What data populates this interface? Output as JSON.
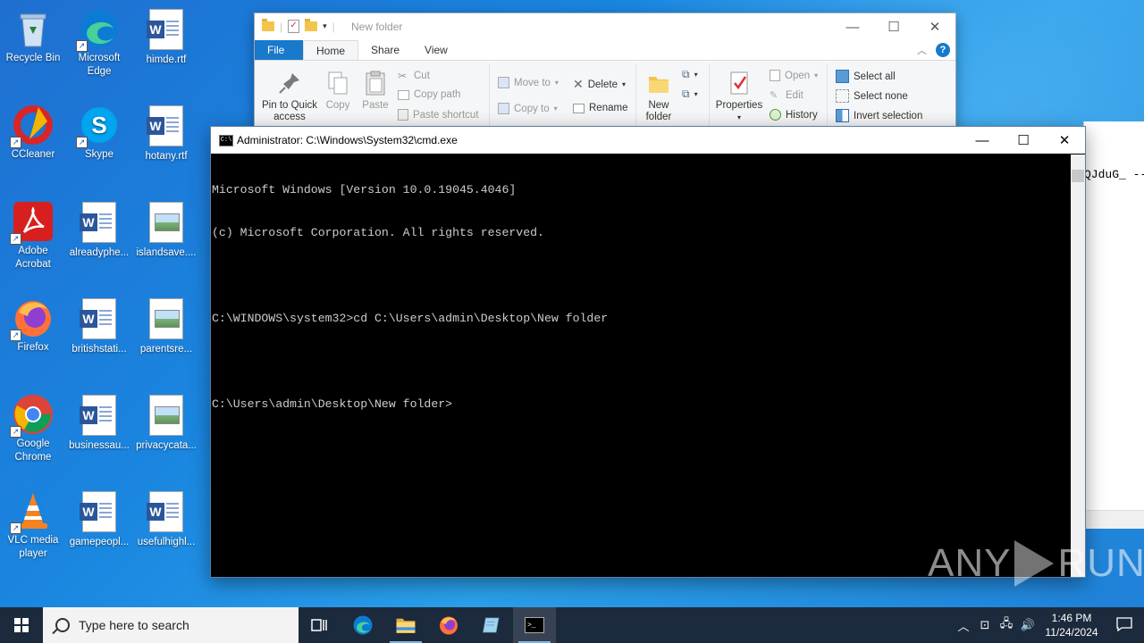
{
  "desktop": {
    "icons": [
      {
        "label": "Recycle Bin"
      },
      {
        "label": "Microsoft Edge"
      },
      {
        "label": "himde.rtf"
      },
      {
        "label": "CCleaner"
      },
      {
        "label": "Skype"
      },
      {
        "label": "hotany.rtf"
      },
      {
        "label": "Adobe Acrobat"
      },
      {
        "label": "alreadyphe..."
      },
      {
        "label": "islandsave...."
      },
      {
        "label": "Firefox"
      },
      {
        "label": "britishstati..."
      },
      {
        "label": "parentsre..."
      },
      {
        "label": "Google Chrome"
      },
      {
        "label": "businessau..."
      },
      {
        "label": "privacycata..."
      },
      {
        "label": "VLC media player"
      },
      {
        "label": "gamepeopl..."
      },
      {
        "label": "usefulhighl..."
      }
    ]
  },
  "explorer": {
    "title": "New folder",
    "tabs": {
      "file": "File",
      "home": "Home",
      "share": "Share",
      "view": "View"
    },
    "ribbon": {
      "pin": "Pin to Quick access",
      "copy": "Copy",
      "paste": "Paste",
      "cut": "Cut",
      "copy_path": "Copy path",
      "paste_shortcut": "Paste shortcut",
      "move_to": "Move to",
      "copy_to": "Copy to",
      "delete": "Delete",
      "rename": "Rename",
      "new_folder": "New folder",
      "properties": "Properties",
      "open": "Open",
      "edit": "Edit",
      "history": "History",
      "select_all": "Select all",
      "select_none": "Select none",
      "invert_selection": "Invert selection"
    }
  },
  "background_window": {
    "text": "QJduG_ --"
  },
  "cmd": {
    "title": "Administrator: C:\\Windows\\System32\\cmd.exe",
    "lines": [
      "Microsoft Windows [Version 10.0.19045.4046]",
      "(c) Microsoft Corporation. All rights reserved.",
      "",
      "C:\\WINDOWS\\system32>cd C:\\Users\\admin\\Desktop\\New folder",
      "",
      "C:\\Users\\admin\\Desktop\\New folder>"
    ]
  },
  "watermark": {
    "left": "ANY",
    "right": "RUN"
  },
  "taskbar": {
    "search_placeholder": "Type here to search",
    "time": "1:46 PM",
    "date": "11/24/2024"
  }
}
